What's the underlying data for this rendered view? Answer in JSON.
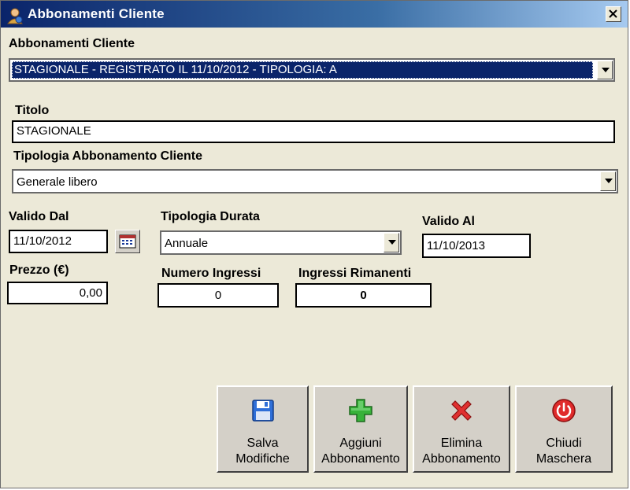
{
  "window": {
    "title": "Abbonamenti Cliente"
  },
  "subscriptions": {
    "label": "Abbonamenti Cliente",
    "selected": "STAGIONALE - REGISTRATO IL 11/10/2012 - TIPOLOGIA: A"
  },
  "titolo": {
    "label": "Titolo",
    "value": "STAGIONALE"
  },
  "tipologia_abbonamento": {
    "label": "Tipologia Abbonamento Cliente",
    "value": "Generale libero"
  },
  "valido_dal": {
    "label": "Valido Dal",
    "value": "11/10/2012"
  },
  "tipologia_durata": {
    "label": "Tipologia Durata",
    "value": "Annuale"
  },
  "valido_al": {
    "label": "Valido Al",
    "value": "11/10/2013"
  },
  "prezzo": {
    "label": "Prezzo (€)",
    "value": "0,00"
  },
  "numero_ingressi": {
    "label": "Numero Ingressi",
    "value": "0"
  },
  "ingressi_rimanenti": {
    "label": "Ingressi Rimanenti",
    "value": "0"
  },
  "buttons": {
    "save": {
      "line1": "Salva",
      "line2": "Modifiche",
      "icon": "floppy-disk-icon"
    },
    "add": {
      "line1": "Aggiuni",
      "line2": "Abbonamento",
      "icon": "green-plus-icon"
    },
    "delete": {
      "line1": "Elimina",
      "line2": "Abbonamento",
      "icon": "red-x-icon"
    },
    "close": {
      "line1": "Chiudi",
      "line2": "Maschera",
      "icon": "power-icon"
    }
  },
  "colors": {
    "selection": "#0a246a",
    "window_bg": "#ece9d8"
  }
}
